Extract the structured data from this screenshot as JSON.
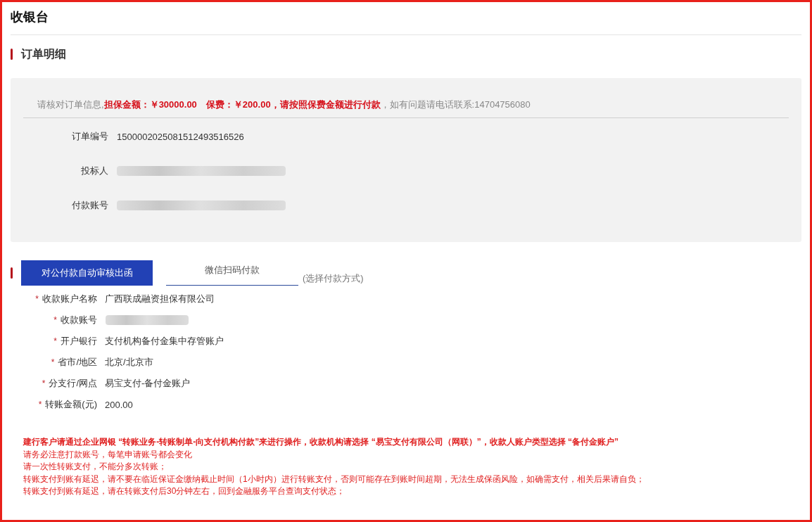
{
  "page_title": "收银台",
  "order_section": {
    "heading": "订单明细",
    "notice": [
      {
        "text": "请核对订单信息,",
        "emphasis": false
      },
      {
        "text": "担保金额：￥30000.00　保费：￥200.00，请按照保费金额进行付款",
        "emphasis": true
      },
      {
        "text": "，如有问题请电话联系:14704756080",
        "emphasis": false
      }
    ],
    "fields": [
      {
        "label": "订单编号",
        "value": "1500002025081512493516526",
        "kind": "text"
      },
      {
        "label": "投标人",
        "kind": "redacted"
      },
      {
        "label": "付款账号",
        "kind": "redacted"
      }
    ]
  },
  "payment_section": {
    "tabs": [
      {
        "label": "对公付款自动审核出函",
        "selected": true
      },
      {
        "label": "微信扫码付款",
        "selected": false
      }
    ],
    "hint": "(选择付款方式)",
    "fields": [
      {
        "label": "收款账户名称",
        "asterisk": "*",
        "kind": "text",
        "value": "广西联成融资担保有限公司"
      },
      {
        "label": "收款账号",
        "asterisk": "*",
        "kind": "redacted"
      },
      {
        "label": "开户银行",
        "asterisk": "*",
        "kind": "text",
        "value": "支付机构备付金集中存管账户"
      },
      {
        "label": "省市/地区",
        "asterisk": "*",
        "kind": "text",
        "value": "北京/北京市"
      },
      {
        "label": "分支行/网点",
        "asterisk": "*",
        "kind": "text",
        "value": "易宝支付-备付金账户"
      },
      {
        "label": "转账金额(元)",
        "asterisk": "*",
        "kind": "text",
        "value": "200.00"
      }
    ],
    "notes": [
      {
        "text": "建行客户请通过企业网银 “转账业务-转账制单-向支付机构付款”来进行操作，收款机构请选择 “易宝支付有限公司（网联）”，收款人账户类型选择 “备付金账户”",
        "kind": "bold"
      },
      {
        "text": "请务必注意打款账号，每笔申请账号都会变化",
        "kind": "plain"
      },
      {
        "text": "请一次性转账支付，不能分多次转账；",
        "kind": "plain"
      },
      {
        "text": "转账支付到账有延迟，请不要在临近保证金缴纳截止时间（1小时内）进行转账支付，否则可能存在到账时间超期，无法生成保函风险，如确需支付，相关后果请自负；",
        "kind": "plain"
      },
      {
        "text": "转账支付到账有延迟，请在转账支付后30分钟左右，回到金融服务平台查询支付状态；",
        "kind": "plain"
      }
    ]
  }
}
